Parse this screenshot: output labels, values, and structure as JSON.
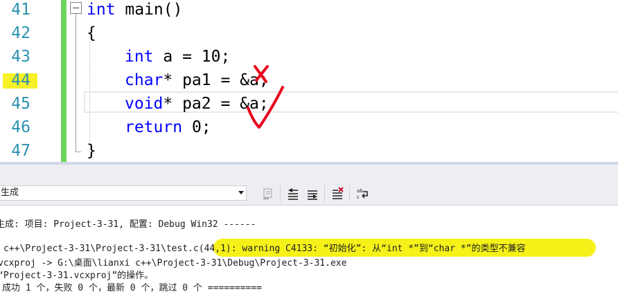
{
  "editor": {
    "line_numbers": [
      "41",
      "42",
      "43",
      "44",
      "45",
      "46",
      "47"
    ],
    "lines": [
      {
        "kw": "int",
        "rest": " main()"
      },
      {
        "kw": "",
        "rest": "{"
      },
      {
        "kw": "int",
        "rest": " a = 10;"
      },
      {
        "kw": "char",
        "rest": "* pa1 = &a;"
      },
      {
        "kw": "void",
        "rest": "* pa2 = &a;"
      },
      {
        "kw": "return",
        "rest": " 0;"
      },
      {
        "kw": "",
        "rest": "}"
      }
    ],
    "annotation_color": "#e8001c",
    "highlight_color": "#f4f000"
  },
  "output_panel": {
    "show_output_from": "生成",
    "toolbar_icons": [
      "go-to-error-icon",
      "previous-message-icon",
      "next-message-icon",
      "clear-all-icon",
      "word-wrap-icon"
    ],
    "lines": [
      "生成: 项目: Project-3-31, 配置: Debug Win32 ------",
      "",
      "c++\\Project-3-31\\Project-3-31\\test.c(44,1): warning C4133: “初始化”: 从“int *”到“char *”的类型不兼容",
      "vcxproj -> G:\\桌面\\lianxi c++\\Project-3-31\\Debug\\Project-3-31.exe",
      "“Project-3-31.vcxproj”的操作。",
      "成功 1 个，失败 0 个，最新 0 个，跳过 0 个 =========="
    ]
  }
}
